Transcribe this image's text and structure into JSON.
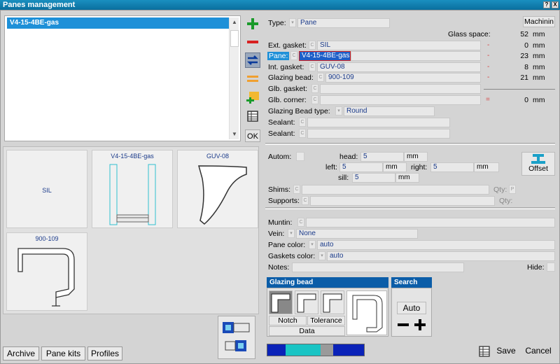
{
  "window": {
    "title": "Panes management",
    "help_glyph": "?",
    "close_glyph": "X"
  },
  "list": {
    "items": [
      "V4-15-4BE-gas"
    ],
    "scroll_up_glyph": "▲",
    "scroll_down_glyph": "▼"
  },
  "toolbar": {
    "ok_label": "OK"
  },
  "gallery": {
    "cards": [
      "SIL",
      "V4-15-4BE-gas",
      "GUV-08",
      "900-109"
    ]
  },
  "bottom_tabs": {
    "archive": "Archive",
    "pane_kits": "Pane kits",
    "profiles": "Profiles"
  },
  "form": {
    "type_label": "Type:",
    "type_value": "Pane",
    "machining_button": "Machinin",
    "glass_space_label": "Glass space:",
    "glass_space_value": "52",
    "glass_space_unit": "mm",
    "ext_gasket_label": "Ext. gasket:",
    "ext_gasket_value": "SIL",
    "ext_gasket_dash": "-",
    "ext_gasket_mm": "0",
    "ext_gasket_unit": "mm",
    "pane_label": "Pane:",
    "pane_value": "V4-15-4BE-gas",
    "pane_dash": "-",
    "pane_mm": "23",
    "pane_unit": "mm",
    "int_gasket_label": "Int. gasket:",
    "int_gasket_value": "GUV-08",
    "int_gasket_dash": "-",
    "int_gasket_mm": "8",
    "int_gasket_unit": "mm",
    "glazing_bead_label": "Glazing bead:",
    "glazing_bead_value": "900-109",
    "glazing_bead_dash": "-",
    "glazing_bead_mm": "21",
    "glazing_bead_unit": "mm",
    "glb_gasket_label": "Glb. gasket:",
    "glb_corner_label": "Glb. corner:",
    "glb_corner_eq": "=",
    "glb_corner_mm": "0",
    "glb_corner_unit": "mm",
    "glazing_bead_type_label": "Glazing Bead type:",
    "glazing_bead_type_value": "Round",
    "sealant_label_1": "Sealant:",
    "sealant_label_2": "Sealant:",
    "autom_label": "Autom:",
    "head_label": "head:",
    "head_value": "5",
    "head_unit": "mm",
    "left_label": "left:",
    "left_value": "5",
    "left_unit": "mm",
    "right_label": "right:",
    "right_value": "5",
    "right_unit": "mm",
    "sill_label": "sill:",
    "sill_value": "5",
    "sill_unit": "mm",
    "offset_label": "Offset",
    "shims_label": "Shims:",
    "shims_qty_label": "Qty:",
    "supports_label": "Supports:",
    "supports_qty_label": "Qty:",
    "muntin_label": "Muntin:",
    "vein_label": "Vein:",
    "vein_value": "None",
    "pane_color_label": "Pane color:",
    "pane_color_value": "auto",
    "gaskets_color_label": "Gaskets color:",
    "gaskets_color_value": "auto",
    "notes_label": "Notes:",
    "hide_label": "Hide:"
  },
  "glazing_bead_group": {
    "title": "Glazing bead",
    "notch": "Notch",
    "tolerance": "Tolerance",
    "data": "Data"
  },
  "search_group": {
    "title": "Search",
    "auto": "Auto"
  },
  "actions": {
    "save": "Save",
    "cancel": "Cancel"
  },
  "colors": {
    "accent": "#0b5da8",
    "selected": "#1e90d8",
    "bar1": "#0a22b8",
    "bar2": "#19c4c4",
    "bar3": "#9a9a9a",
    "bar4": "#0a22b8"
  }
}
